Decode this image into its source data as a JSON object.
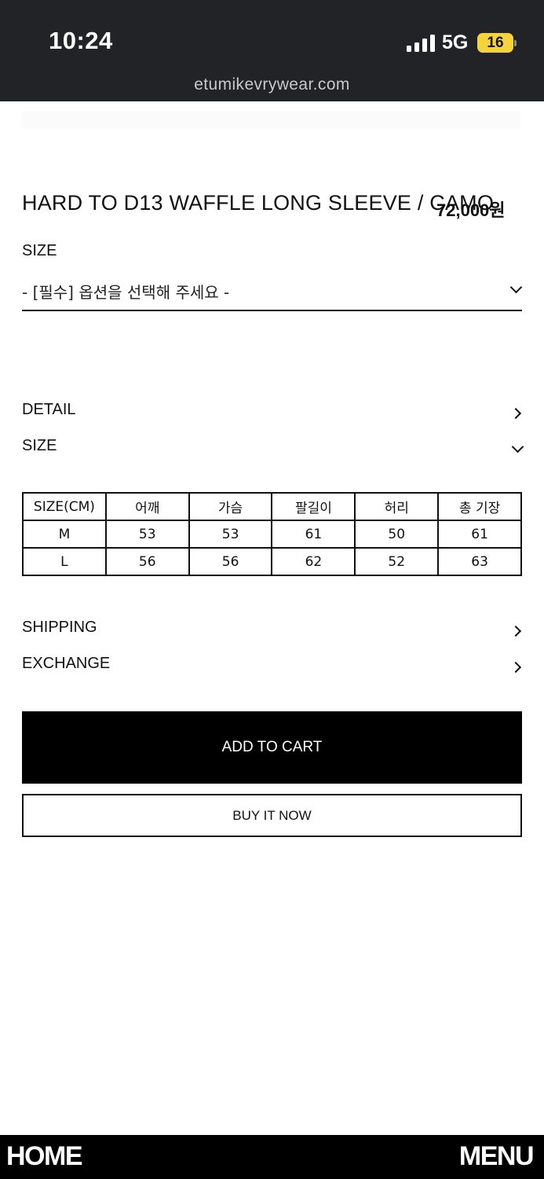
{
  "status_bar": {
    "time": "10:24",
    "network": "5G",
    "battery": "16",
    "url": "etumikevrywear.com",
    "icons": [
      "signal-icon",
      "battery-icon"
    ],
    "battery_color": "#f5d33a"
  },
  "product": {
    "title": "HARD TO D13 WAFFLE LONG SLEEVE / CAMO",
    "price": "72,000원"
  },
  "option": {
    "label": "SIZE",
    "placeholder": "- [필수] 옵션을 선택해 주세요 -"
  },
  "sections": {
    "detail": "DETAIL",
    "size": "SIZE",
    "shipping": "SHIPPING",
    "exchange": "EXCHANGE"
  },
  "size_table": {
    "headers": [
      "SIZE(CM)",
      "어깨",
      "가슴",
      "팔길이",
      "허리",
      "총 기장"
    ],
    "rows": [
      [
        "M",
        "53",
        "53",
        "61",
        "50",
        "61"
      ],
      [
        "L",
        "56",
        "56",
        "62",
        "52",
        "63"
      ]
    ]
  },
  "buttons": {
    "add_to_cart": "ADD TO CART",
    "buy_now": "BUY IT NOW"
  },
  "bottom_nav": {
    "home": "HOME",
    "menu": "MENU"
  }
}
